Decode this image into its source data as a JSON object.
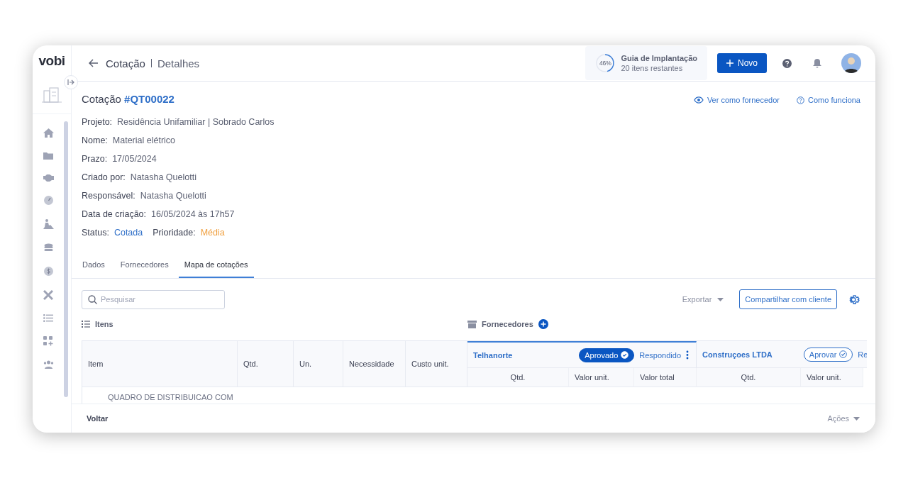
{
  "logo": "vobi",
  "header": {
    "breadcrumb": [
      "Cotação",
      "Detalhes"
    ],
    "guide": {
      "percent": "46%",
      "level": 0.46,
      "title": "Guia de Implantação",
      "subtitle": "20 itens restantes"
    },
    "new_button": "Novo"
  },
  "quote": {
    "title": "Cotação",
    "code": "#QT00022",
    "links": [
      "Ver como fornecedor",
      "Como funciona"
    ],
    "fields": [
      {
        "label": "Projeto:",
        "value": "Residência Unifamiliar | Sobrado Carlos"
      },
      {
        "label": "Nome:",
        "value": "Material elétrico"
      },
      {
        "label": "Prazo:",
        "value": "17/05/2024"
      },
      {
        "label": "Criado por:",
        "value": "Natasha Quelotti"
      },
      {
        "label": "Responsável:",
        "value": "Natasha Quelotti"
      },
      {
        "label": "Data de criação:",
        "value": "16/05/2024 às 17h57"
      }
    ],
    "status": {
      "label": "Status:",
      "value": "Cotada"
    },
    "priority": {
      "label": "Prioridade:",
      "value": "Média"
    }
  },
  "tabs": [
    {
      "label": "Dados",
      "selected": false
    },
    {
      "label": "Fornecedores",
      "selected": false
    },
    {
      "label": "Mapa de cotações",
      "selected": true
    }
  ],
  "toolbar": {
    "search_placeholder": "Pesquisar",
    "export": "Exportar",
    "share": "Compartilhar com cliente"
  },
  "items_label": "Itens",
  "suppliers_label": "Fornecedores",
  "table": {
    "columns": [
      "Item",
      "Qtd.",
      "Un.",
      "Necessidade",
      "Custo unit."
    ],
    "suppliers": [
      {
        "name": "Telhanorte",
        "approval": "Aprovado",
        "approved": true,
        "response": "Respondido",
        "columns": [
          "Qtd.",
          "Valor unit.",
          "Valor total"
        ]
      },
      {
        "name": "Construçoes LTDA",
        "approval": "Aprovar",
        "approved": false,
        "response": "Re",
        "columns": [
          "Qtd.",
          "Valor unit."
        ]
      }
    ],
    "rows": [
      {
        "item": "QUADRO DE DISTRIBUICAO COM"
      }
    ]
  },
  "footer": {
    "back": "Voltar",
    "actions": "Ações"
  }
}
